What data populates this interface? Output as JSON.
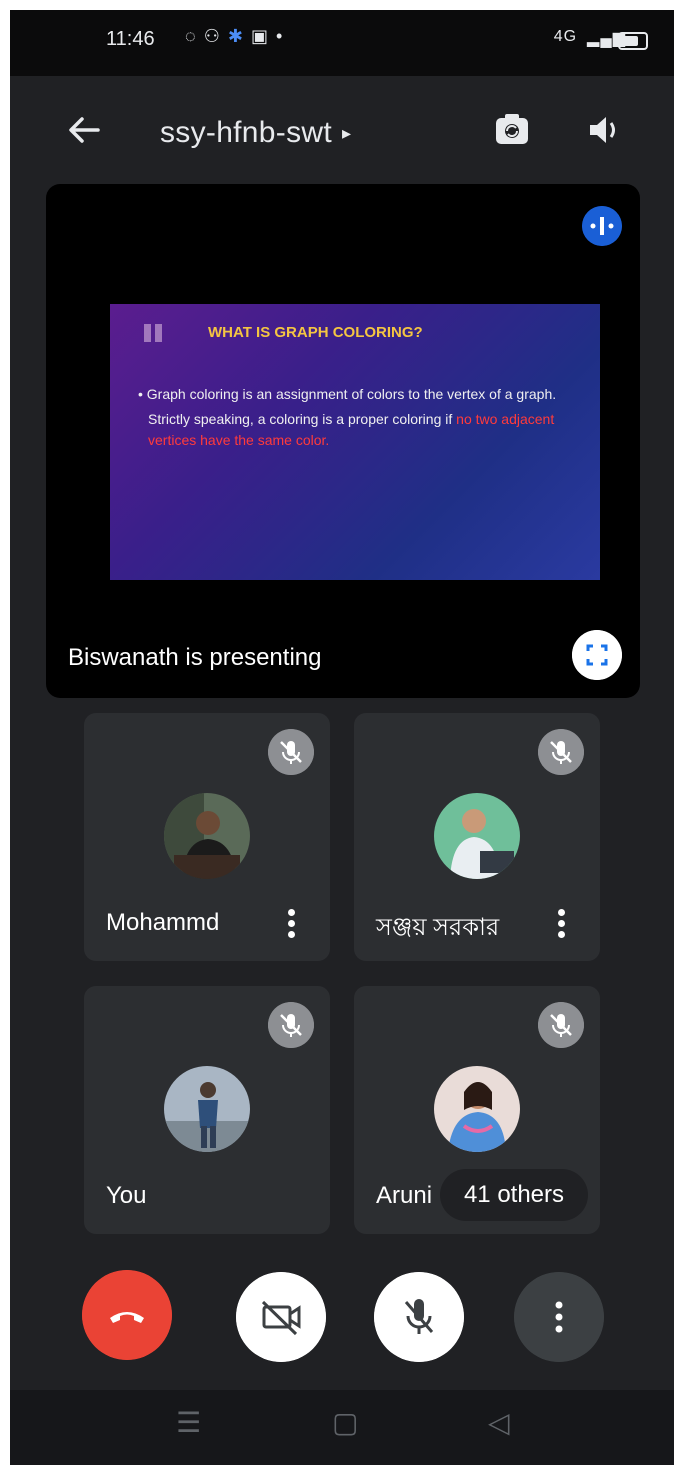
{
  "status_bar": {
    "time": "11:46",
    "network": "4G"
  },
  "header": {
    "meeting_code": "ssy-hfnb-swt",
    "caret": "▸"
  },
  "presentation": {
    "slide_title": "WHAT IS GRAPH COLORING?",
    "slide_line1": "• Graph coloring is an assignment of colors to the vertex of a graph.",
    "slide_line2": "Strictly speaking, a coloring is a proper coloring if",
    "slide_line2_red": "no two adjacent vertices have the same color.",
    "presenting_label": "Biswanath is presenting"
  },
  "participants": [
    {
      "name": "Mohammd"
    },
    {
      "name": "সঞ্জয় সরকার"
    },
    {
      "name": "You"
    },
    {
      "name": "Aruni"
    }
  ],
  "others_label": "41 others",
  "colors": {
    "background": "#202124",
    "tile": "#2c2e31",
    "hangup": "#ea4335",
    "pin": "#1a5fd6"
  }
}
